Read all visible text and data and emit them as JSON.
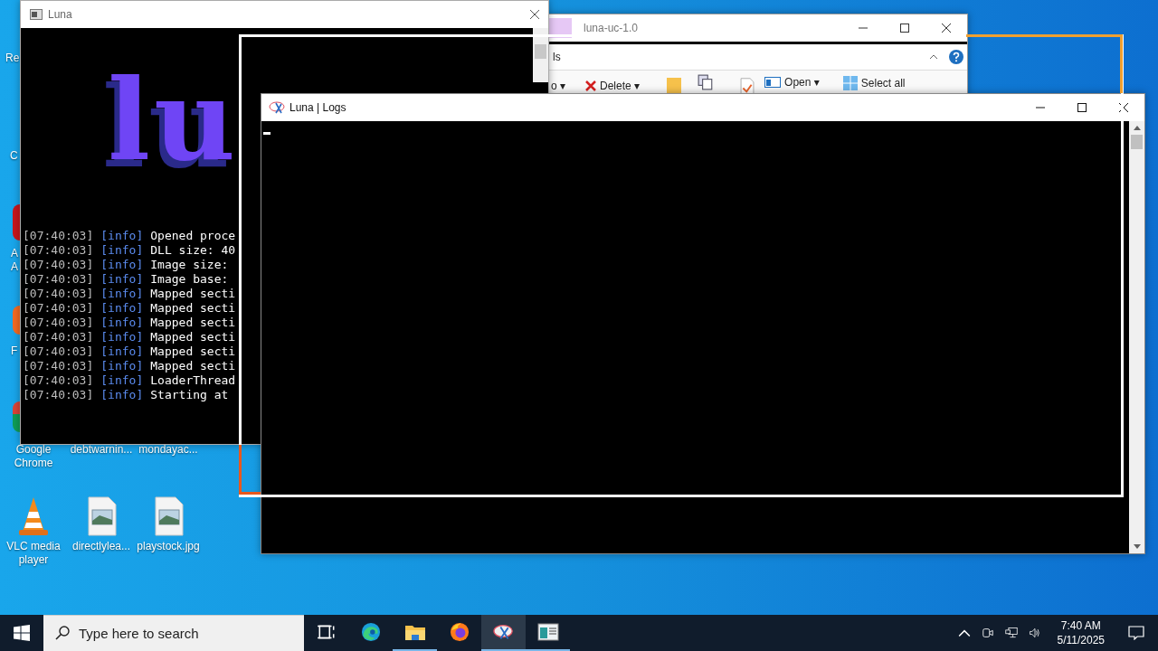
{
  "desktop_icons": [
    {
      "label": "Re",
      "kind": "label"
    },
    {
      "label": "C",
      "kind": "label"
    },
    {
      "label": "A",
      "kind": "label"
    },
    {
      "label": "A",
      "kind": "label"
    },
    {
      "label": "F",
      "kind": "label"
    },
    {
      "label": "Google Chrome",
      "kind": "label"
    },
    {
      "label": "debtwarnin...",
      "kind": "label"
    },
    {
      "label": "mondayac...",
      "kind": "label"
    },
    {
      "label": "VLC media player",
      "kind": "vlc"
    },
    {
      "label": "directlylea...",
      "kind": "image"
    },
    {
      "label": "playstock.jpg",
      "kind": "image"
    }
  ],
  "console_window": {
    "title": "Luna",
    "logo": "lu",
    "log_lines": [
      {
        "time": "[07:40:03]",
        "level": "[info]",
        "message": "Opened proce"
      },
      {
        "time": "[07:40:03]",
        "level": "[info]",
        "message": "DLL size: 40"
      },
      {
        "time": "[07:40:03]",
        "level": "[info]",
        "message": "Image size:"
      },
      {
        "time": "[07:40:03]",
        "level": "[info]",
        "message": "Image base:"
      },
      {
        "time": "[07:40:03]",
        "level": "[info]",
        "message": "Mapped secti"
      },
      {
        "time": "[07:40:03]",
        "level": "[info]",
        "message": "Mapped secti"
      },
      {
        "time": "[07:40:03]",
        "level": "[info]",
        "message": "Mapped secti"
      },
      {
        "time": "[07:40:03]",
        "level": "[info]",
        "message": "Mapped secti"
      },
      {
        "time": "[07:40:03]",
        "level": "[info]",
        "message": "Mapped secti"
      },
      {
        "time": "[07:40:03]",
        "level": "[info]",
        "message": "Mapped secti"
      },
      {
        "time": "[07:40:03]",
        "level": "[info]",
        "message": "LoaderThread"
      },
      {
        "time": "[07:40:03]",
        "level": "[info]",
        "message": "Starting at"
      }
    ]
  },
  "explorer_window": {
    "title": "luna-uc-1.0",
    "tab": "ls",
    "ribbon": [
      {
        "label": "o ▾",
        "kind": "dropdown"
      },
      {
        "label": "Delete ▾",
        "kind": "delete"
      },
      {
        "label": "Open ▾",
        "kind": "open"
      },
      {
        "label": "Select all",
        "kind": "select"
      }
    ]
  },
  "logs_window": {
    "title": "Luna | Logs"
  },
  "taskbar": {
    "search": {
      "placeholder": "Type here to search"
    },
    "apps": [
      {
        "kind": "task-view",
        "running": false,
        "selected": false
      },
      {
        "kind": "edge",
        "running": false,
        "selected": false
      },
      {
        "kind": "folder",
        "running": true,
        "selected": false
      },
      {
        "kind": "firefox",
        "running": false,
        "selected": false
      },
      {
        "kind": "snipping",
        "running": true,
        "selected": true
      },
      {
        "kind": "console",
        "running": true,
        "selected": false
      }
    ],
    "time": "7:40 AM",
    "date": "5/11/2025"
  }
}
